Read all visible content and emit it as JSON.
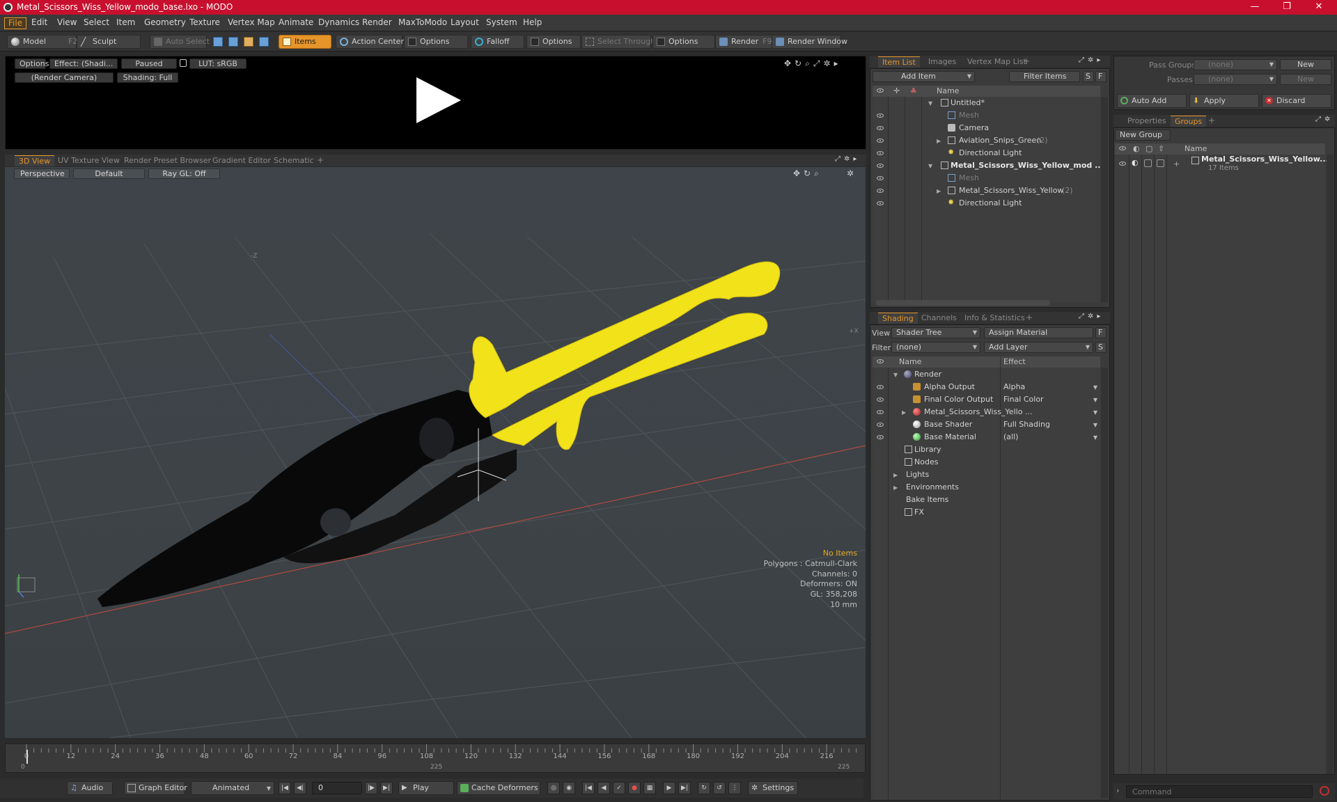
{
  "window": {
    "title": "Metal_Scissors_Wiss_Yellow_modo_base.lxo - MODO",
    "minimize": "—",
    "maximize": "❐",
    "close": "✕"
  },
  "menu": [
    "File",
    "Edit",
    "View",
    "Select",
    "Item",
    "Geometry",
    "Texture",
    "Vertex Map",
    "Animate",
    "Dynamics",
    "Render",
    "MaxToModo",
    "Layout",
    "System",
    "Help"
  ],
  "toolbar": {
    "model": "Model",
    "model_key": "F2",
    "sculpt": "Sculpt",
    "auto_select": "Auto Select",
    "items": "Items",
    "action_center": "Action Center",
    "options1": "Options",
    "falloff": "Falloff",
    "options2": "Options",
    "select_through": "Select Through",
    "options3": "Options",
    "render": "Render",
    "render_key": "F9",
    "render_window": "Render Window"
  },
  "preview": {
    "options": "Options",
    "effect": "Effect: (Shadi...",
    "paused": "Paused",
    "lut": "LUT: sRGB",
    "camera": "(Render Camera)",
    "shading": "Shading: Full"
  },
  "view_tabs": [
    "3D View",
    "UV Texture View",
    "Render Preset Browser",
    "Gradient Editor",
    "Schematic"
  ],
  "viewport": {
    "perspective": "Perspective",
    "default": "Default",
    "raygl": "Ray GL: Off",
    "axis_z": "-Z",
    "axis_x": "+X",
    "info": {
      "no_items": "No Items",
      "polygons": "Polygons : Catmull-Clark",
      "channels": "Channels: 0",
      "deformers": "Deformers: ON",
      "gl": "GL: 358,208",
      "scale": "10 mm"
    }
  },
  "timeline": {
    "ticks": [
      "0",
      "12",
      "24",
      "36",
      "48",
      "60",
      "72",
      "84",
      "96",
      "108",
      "120",
      "132",
      "144",
      "156",
      "168",
      "180",
      "192",
      "204",
      "216"
    ],
    "start": "0",
    "mid": "225",
    "end": "225"
  },
  "bottombar": {
    "audio": "Audio",
    "graph_editor": "Graph Editor",
    "animated": "Animated",
    "frame": "0",
    "play": "Play",
    "cache_deformers": "Cache Deformers",
    "settings": "Settings"
  },
  "item_list": {
    "tabs": [
      "Item List",
      "Images",
      "Vertex Map List"
    ],
    "add_item": "Add Item",
    "filter_items": "Filter Items",
    "s_btn": "S",
    "f_btn": "F",
    "col_name": "Name",
    "rows": [
      {
        "label": "Untitled*",
        "count": ""
      },
      {
        "label": "Mesh",
        "count": ""
      },
      {
        "label": "Camera",
        "count": ""
      },
      {
        "label": "Aviation_Snips_Green",
        "count": "(2)"
      },
      {
        "label": "Directional Light",
        "count": ""
      },
      {
        "label": "Metal_Scissors_Wiss_Yellow_mod ...",
        "count": ""
      },
      {
        "label": "Mesh",
        "count": ""
      },
      {
        "label": "Metal_Scissors_Wiss_Yellow",
        "count": "(2)"
      },
      {
        "label": "Directional Light",
        "count": ""
      }
    ]
  },
  "shading": {
    "tabs": [
      "Shading",
      "Channels",
      "Info & Statistics"
    ],
    "view_label": "View",
    "view_value": "Shader Tree",
    "assign_material": "Assign Material",
    "f_btn": "F",
    "filter_label": "Filter",
    "filter_value": "(none)",
    "add_layer": "Add Layer",
    "s_btn": "S",
    "col_name": "Name",
    "col_effect": "Effect",
    "rows": [
      {
        "label": "Render",
        "effect": ""
      },
      {
        "label": "Alpha Output",
        "effect": "Alpha"
      },
      {
        "label": "Final Color Output",
        "effect": "Final Color"
      },
      {
        "label": "Metal_Scissors_Wiss_Yello ...",
        "effect": ""
      },
      {
        "label": "Base Shader",
        "effect": "Full Shading"
      },
      {
        "label": "Base Material",
        "effect": "(all)"
      },
      {
        "label": "Library",
        "effect": ""
      },
      {
        "label": "Nodes",
        "effect": ""
      },
      {
        "label": "Lights",
        "effect": ""
      },
      {
        "label": "Environments",
        "effect": ""
      },
      {
        "label": "Bake Items",
        "effect": ""
      },
      {
        "label": "FX",
        "effect": ""
      }
    ]
  },
  "groups_panel": {
    "pass_groups_label": "Pass Groups",
    "pass_groups_value": "(none)",
    "new_btn": "New",
    "passes_label": "Passes",
    "passes_value": "(none)",
    "new_btn2": "New",
    "auto_add": "Auto Add",
    "apply": "Apply",
    "discard": "Discard",
    "tabs": [
      "Properties",
      "Groups"
    ],
    "new_group": "New Group",
    "col_name": "Name",
    "group_name": "Metal_Scissors_Wiss_Yellow...",
    "group_count": "17 Items"
  },
  "command": {
    "placeholder": "Command"
  },
  "colors": {
    "accent": "#e6952a",
    "title_bar": "#c8102e",
    "handle_yellow": "#f2e21a",
    "metal_black": "#080808"
  }
}
